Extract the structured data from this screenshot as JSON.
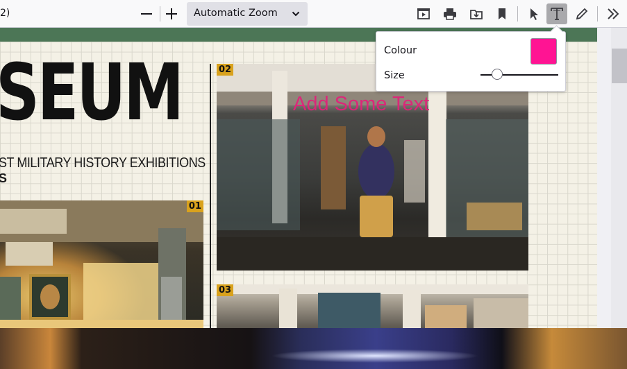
{
  "toolbar": {
    "page_indicator": "2)",
    "zoom_value": "Automatic Zoom",
    "zoom_out_icon": "minus-icon",
    "zoom_in_icon": "plus-icon",
    "presentation_icon": "presentation-icon",
    "print_icon": "print-icon",
    "save_icon": "save-download-icon",
    "bookmark_icon": "bookmark-icon",
    "cursor_icon": "cursor-icon",
    "text_tool_icon": "text-tool-icon",
    "draw_icon": "pencil-icon",
    "more_icon": "double-chevron-icon"
  },
  "document": {
    "headline": "SEUM",
    "subhead": "ST MILITARY HISTORY EXHIBITIONS",
    "subhead2": "S",
    "badge_01": "01",
    "badge_02": "02",
    "badge_03": "03",
    "annotation_text": "Add Some Text",
    "annotation_color": "#e0237a",
    "band_color": "#4c7656"
  },
  "text_popup": {
    "colour_label": "Colour",
    "size_label": "Size",
    "colour_value": "#ff1493",
    "size_slider_fraction": 0.18
  }
}
